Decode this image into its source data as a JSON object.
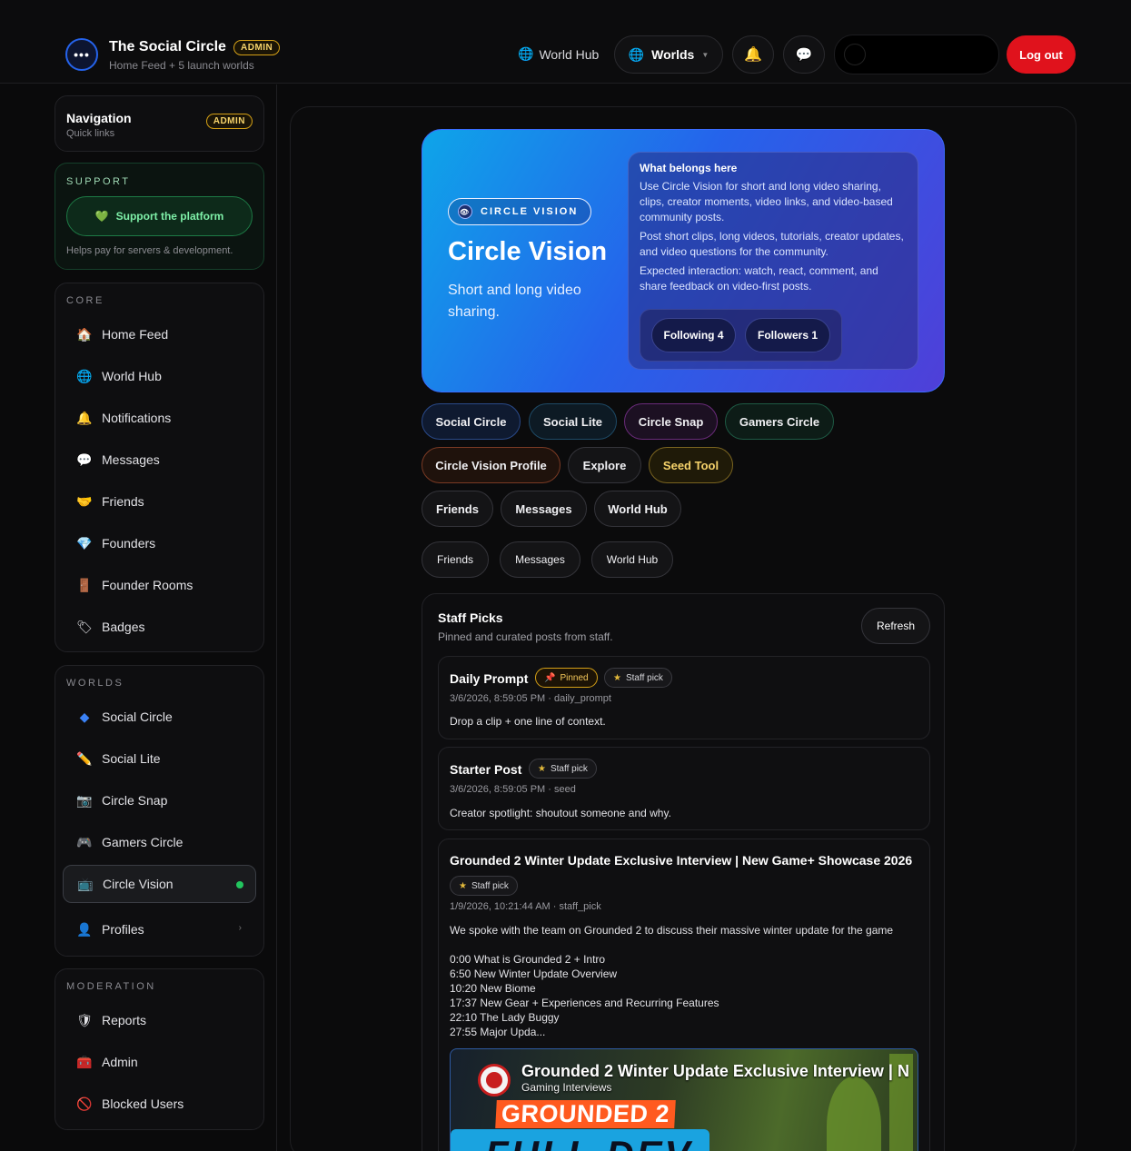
{
  "header": {
    "brand_title": "The Social Circle",
    "brand_badge": "ADMIN",
    "brand_sub": "Home Feed + 5 launch worlds",
    "world_hub": "World Hub",
    "worlds": "Worlds",
    "logout": "Log out"
  },
  "sidebar": {
    "nav_title": "Navigation",
    "nav_sub": "Quick links",
    "nav_badge": "ADMIN",
    "support_label": "SUPPORT",
    "support_button": "Support the platform",
    "support_note": "Helps pay for servers & development.",
    "core_label": "CORE",
    "core_items": [
      {
        "label": "Home Feed",
        "icon": "house-icon"
      },
      {
        "label": "World Hub",
        "icon": "globe-icon"
      },
      {
        "label": "Notifications",
        "icon": "bell-icon"
      },
      {
        "label": "Messages",
        "icon": "speech-bubble-icon"
      },
      {
        "label": "Friends",
        "icon": "handshake-icon"
      },
      {
        "label": "Founders",
        "icon": "gem-icon"
      },
      {
        "label": "Founder Rooms",
        "icon": "door-icon"
      },
      {
        "label": "Badges",
        "icon": "ticket-icon"
      }
    ],
    "worlds_label": "WORLDS",
    "world_items": [
      {
        "label": "Social Circle",
        "icon": "diamond-icon"
      },
      {
        "label": "Social Lite",
        "icon": "pencil-icon"
      },
      {
        "label": "Circle Snap",
        "icon": "camera-icon"
      },
      {
        "label": "Gamers Circle",
        "icon": "gamepad-icon"
      },
      {
        "label": "Circle Vision",
        "icon": "tv-icon",
        "active": true
      },
      {
        "label": "Profiles",
        "icon": "person-icon"
      }
    ],
    "mod_label": "MODERATION",
    "mod_items": [
      {
        "label": "Reports",
        "icon": "shield-icon"
      },
      {
        "label": "Admin",
        "icon": "toolbox-icon"
      },
      {
        "label": "Blocked Users",
        "icon": "blocked-icon"
      }
    ]
  },
  "hero": {
    "chip": "CIRCLE VISION",
    "title": "Circle Vision",
    "subtitle": "Short and long video sharing.",
    "box_title": "What belongs here",
    "p1": "Use Circle Vision for short and long video sharing, clips, creator moments, video links, and video-based community posts.",
    "p2": "Post short clips, long videos, tutorials, creator updates, and video questions for the community.",
    "p3": "Expected interaction: watch, react, comment, and share feedback on video-first posts.",
    "following": "Following 4",
    "followers": "Followers 1"
  },
  "tags": {
    "row1": [
      "Social Circle",
      "Social Lite",
      "Circle Snap",
      "Gamers Circle"
    ],
    "row2": [
      "Circle Vision Profile",
      "Explore",
      "Seed Tool"
    ],
    "row3": [
      "Friends",
      "Messages",
      "World Hub"
    ],
    "row4": [
      "Friends",
      "Messages",
      "World Hub"
    ]
  },
  "picks": {
    "title": "Staff Picks",
    "sub": "Pinned and curated posts from staff.",
    "refresh": "Refresh",
    "pinned_label": "Pinned",
    "staff_label": "Staff pick",
    "posts": [
      {
        "title": "Daily Prompt",
        "meta": "3/6/2026, 8:59:05 PM · daily_prompt",
        "body": "Drop a clip + one line of context."
      },
      {
        "title": "Starter Post",
        "meta": "3/6/2026, 8:59:05 PM · seed",
        "body": "Creator spotlight: shoutout someone and why."
      },
      {
        "title": "Grounded 2 Winter Update Exclusive Interview | New Game+ Showcase 2026",
        "meta": "1/9/2026, 10:21:44 AM · staff_pick",
        "body": "We spoke with the team on Grounded 2 to discuss their massive winter update for the game\n\n0:00 What is Grounded 2 + Intro\n6:50 New Winter Update Overview\n10:20 New Biome\n17:37 New Gear + Experiences and Recurring Features\n22:10 The Lady Buggy\n27:55 Major Upda..."
      }
    ],
    "thumb_title": "Grounded 2 Winter Update Exclusive Interview | N",
    "thumb_channel": "Gaming Interviews",
    "thumb_game": "GROUNDED 2",
    "thumb_band": "FULL DEV"
  }
}
